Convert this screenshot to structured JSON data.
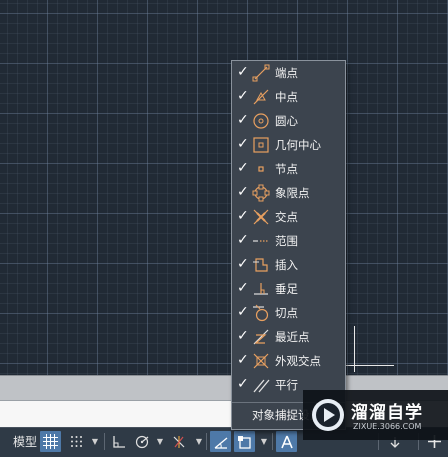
{
  "status_bar": {
    "model_label": "模型",
    "tools": [
      {
        "icon": "grid-display-icon",
        "active": true
      },
      {
        "icon": "snap-mode-icon",
        "active": false
      },
      {
        "icon": "ortho-icon",
        "active": false
      },
      {
        "icon": "polar-tracking-icon",
        "active": false
      },
      {
        "icon": "isometric-icon",
        "active": false
      },
      {
        "icon": "object-snap-tracking-icon",
        "active": true
      },
      {
        "icon": "object-snap-icon",
        "active": true
      },
      {
        "icon": "annotation-scale-icon",
        "active": true
      },
      {
        "icon": "plus-icon",
        "active": false
      }
    ]
  },
  "osnap_menu": {
    "items": [
      {
        "label": "端点",
        "checked": true,
        "icon": "endpoint-icon"
      },
      {
        "label": "中点",
        "checked": true,
        "icon": "midpoint-icon"
      },
      {
        "label": "圆心",
        "checked": true,
        "icon": "center-icon"
      },
      {
        "label": "几何中心",
        "checked": true,
        "icon": "geometric-center-icon"
      },
      {
        "label": "节点",
        "checked": true,
        "icon": "node-icon"
      },
      {
        "label": "象限点",
        "checked": true,
        "icon": "quadrant-icon"
      },
      {
        "label": "交点",
        "checked": true,
        "icon": "intersection-icon"
      },
      {
        "label": "范围",
        "checked": true,
        "icon": "extension-icon"
      },
      {
        "label": "插入",
        "checked": true,
        "icon": "insertion-icon"
      },
      {
        "label": "垂足",
        "checked": true,
        "icon": "perpendicular-icon"
      },
      {
        "label": "切点",
        "checked": true,
        "icon": "tangent-icon"
      },
      {
        "label": "最近点",
        "checked": true,
        "icon": "nearest-icon"
      },
      {
        "label": "外观交点",
        "checked": true,
        "icon": "apparent-intersection-icon"
      },
      {
        "label": "平行",
        "checked": true,
        "icon": "parallel-icon"
      }
    ],
    "footer_label": "对象捕捉设置...",
    "check_glyph": "✓"
  },
  "watermark": {
    "title": "溜溜自学",
    "url": "ZIXUE.3066.COM"
  },
  "colors": {
    "icon_orange": "#e8a060",
    "menu_bg": "#3c444e",
    "active_btn": "#4e79a8"
  }
}
